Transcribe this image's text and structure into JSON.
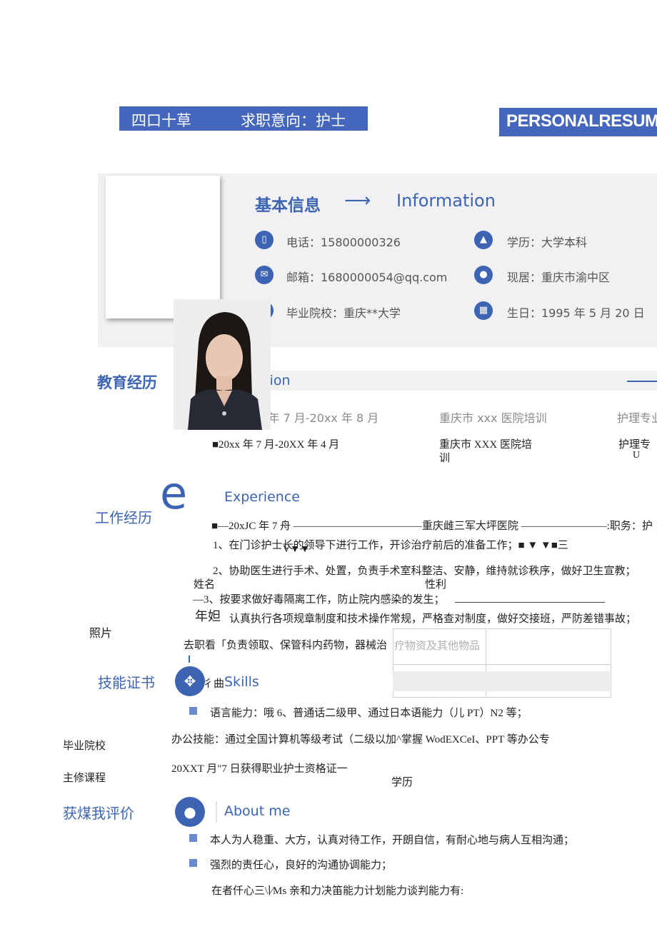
{
  "header": {
    "left_name": "四口十草",
    "left_intent": "求职意向：护士",
    "right_title": "PERSONALRESUMI"
  },
  "info": {
    "title_cn": "基本信息",
    "arrow": "⟶",
    "title_en": "Information",
    "phone": "电话：15800000326",
    "degree": "学历：大学本科",
    "email": "邮箱：1680000054@qq.com",
    "residence": "现居：重庆市渝中区",
    "school": "毕业院校：重庆**大学",
    "birthday": "生日：1995 年 5 月 20 日"
  },
  "education": {
    "title_cn": "教育经历",
    "title_en": "Education",
    "row1": {
      "date": "20xx 年 7 月-20xx 年 8 月",
      "place": "重庆市 xxx 医院培训",
      "major": "护理专业"
    },
    "row2": {
      "date": "■20xx 年 7 月-20XX 年 4 月",
      "place_a": "重庆市 XXX 医院培",
      "place_b": "训",
      "major_a": "护理专",
      "major_b": "U"
    }
  },
  "work": {
    "title_cn": "工作经历",
    "big_letter": "e",
    "title_en": "Experience",
    "line_head": "■—20xJC 年 7 舟 ————————————重庆雌三军大坪医院 ————————:职务：护",
    "item1": "1、在门诊护士长的领导下进行工作，开诊治疗前后的准备工作；■          ▼          ▼■三",
    "item1_marks": "V▼▼",
    "item2": "2、协助医生进行手术、处置，负责手术室科整洁、安静，维持就诊秩序，做好卫生宣教；",
    "label_name": "姓名",
    "label_gender": "性利",
    "item3": "—3、按要求做好毒隔离工作，防止院内感染的发生；",
    "label_age": "年妲",
    "item4": "认真执行各项规章制度和技术操作常规，严格查对制度，做好交接班，严防差错事故；",
    "label_photo": "照片",
    "item5": "去职看「负责领取、保管科内药物，器械治",
    "item5_tail": "疗物资及其他物品"
  },
  "skills": {
    "title_cn": "技能证书",
    "prefix": "彳曲",
    "title_en": "Skills",
    "lang": "语言能力：哦 6、普通话二级甲、通过日本语能力（儿 PT）N2 等；",
    "office": "办公技能：通过全国计算机等级考试（二级以加^掌握 WodEXCeI、PPT 等办公专",
    "cert": "20XXT 月\"7 日获得职业护士资格证一",
    "label_school": "毕业院校",
    "label_course": "主修课程",
    "label_degree": "学历"
  },
  "about": {
    "title_cn": "获煤我评价",
    "title_en": "About me",
    "item1": "本人为人稳重、大方，认真对待工作，开朗自信，有耐心地与病人互相沟通；",
    "item2": "强烈的责任心，良好的沟通协调能力；",
    "item3": "在者仟心三\\∣∕Ms 亲和力决笛能力计划能力谈判能力有:"
  },
  "colors": {
    "accent": "#3d64b3",
    "accent_light": "#6a8bd1",
    "panel": "#f1f1f3"
  }
}
